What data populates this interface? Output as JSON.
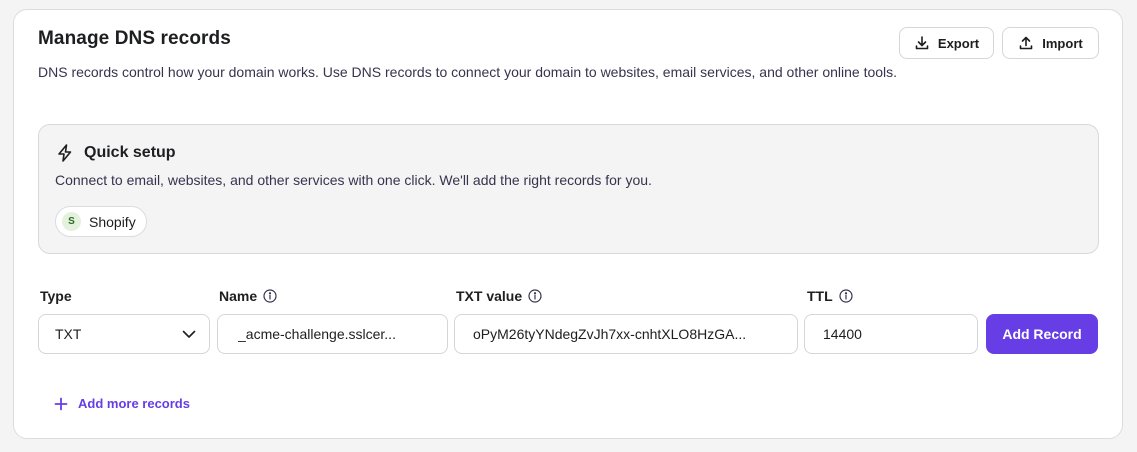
{
  "header": {
    "title": "Manage DNS records",
    "description": "DNS records control how your domain works. Use DNS records to connect your domain to websites, email services, and other online tools.",
    "export_label": "Export",
    "import_label": "Import"
  },
  "quick_setup": {
    "title": "Quick setup",
    "description": "Connect to email, websites, and other services with one click. We'll add the right records for you.",
    "services": [
      {
        "initial": "S",
        "label": "Shopify"
      }
    ]
  },
  "form": {
    "type": {
      "label": "Type",
      "value": "TXT"
    },
    "name": {
      "label": "Name",
      "value": "_acme-challenge.sslcer..."
    },
    "txt_value": {
      "label": "TXT value",
      "value": "oPyM26tyYNdegZvJh7xx-cnhtXLO8HzGA..."
    },
    "ttl": {
      "label": "TTL",
      "value": "14400"
    },
    "add_record_label": "Add Record",
    "add_more_label": "Add more records"
  },
  "colors": {
    "accent": "#673de6",
    "panel_bg": "#f4f4f5"
  }
}
